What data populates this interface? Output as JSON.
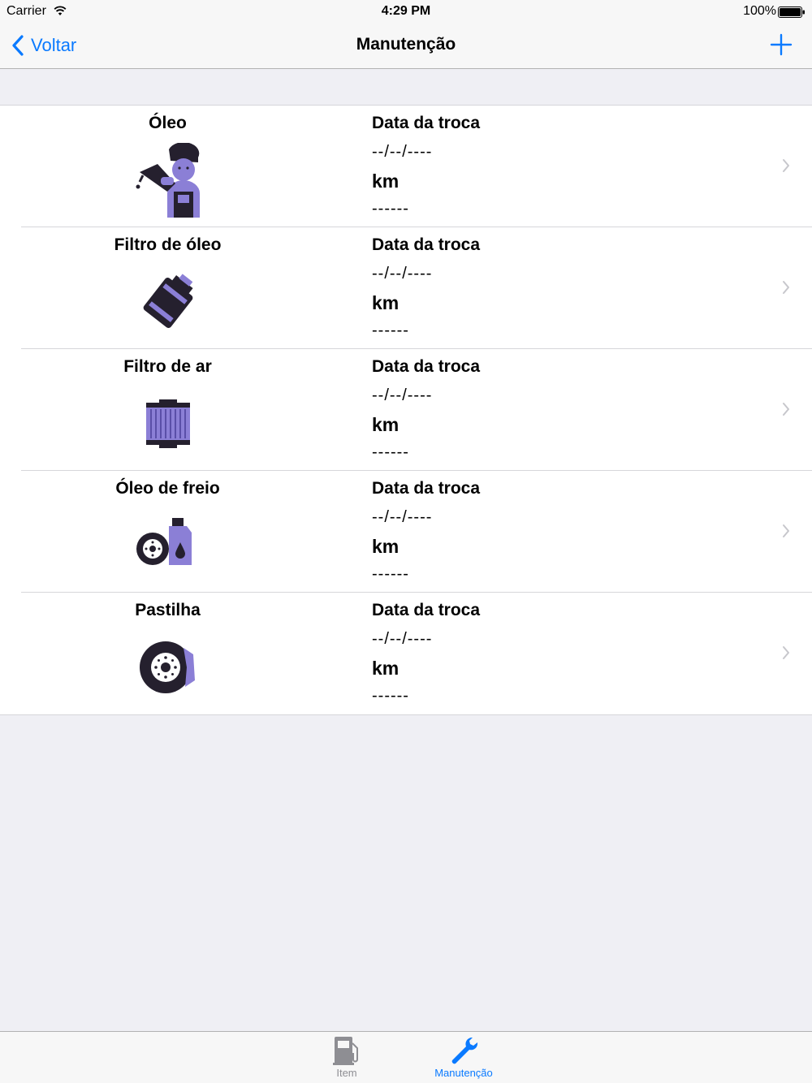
{
  "status_bar": {
    "carrier": "Carrier",
    "time": "4:29 PM",
    "battery": "100%"
  },
  "nav": {
    "back_label": "Voltar",
    "title": "Manutenção",
    "add_icon": "plus-icon"
  },
  "colors": {
    "accent": "#0a7aff",
    "icon_purple": "#8b7fd6",
    "icon_dark": "#25202e",
    "background": "#efeff4"
  },
  "items": [
    {
      "name": "Óleo",
      "icon": "mechanic-oil-icon",
      "date_label": "Data da troca",
      "date_value": "--/--/----",
      "km_label": "km",
      "km_value": "------"
    },
    {
      "name": "Filtro de óleo",
      "icon": "oil-filter-icon",
      "date_label": "Data da troca",
      "date_value": "--/--/----",
      "km_label": "km",
      "km_value": "------"
    },
    {
      "name": "Filtro de ar",
      "icon": "air-filter-icon",
      "date_label": "Data da troca",
      "date_value": "--/--/----",
      "km_label": "km",
      "km_value": "------"
    },
    {
      "name": "Óleo de freio",
      "icon": "brake-fluid-icon",
      "date_label": "Data da troca",
      "date_value": "--/--/----",
      "km_label": "km",
      "km_value": "------"
    },
    {
      "name": "Pastilha",
      "icon": "brake-pad-icon",
      "date_label": "Data da troca",
      "date_value": "--/--/----",
      "km_label": "km",
      "km_value": "------"
    }
  ],
  "tabs": [
    {
      "label": "Item",
      "icon": "fuel-pump-icon",
      "selected": false
    },
    {
      "label": "Manutenção",
      "icon": "wrench-icon",
      "selected": true
    }
  ]
}
